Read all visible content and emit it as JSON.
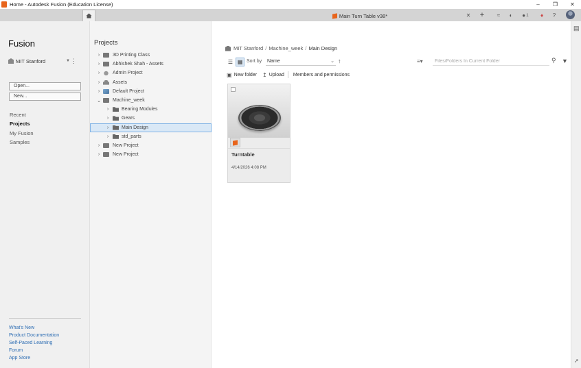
{
  "window": {
    "title": "Home - Autodesk Fusion (Education License)",
    "controls": [
      "minimize",
      "restore",
      "close"
    ]
  },
  "tabs": {
    "home_icon": "home-icon",
    "active_doc": "Main Turn Table v38*",
    "notification_count": "1"
  },
  "sidebar": {
    "brand": "Fusion",
    "hub": "MIT Stanford",
    "open_label": "Open...",
    "new_label": "New...",
    "nav": [
      {
        "label": "Recent",
        "active": false
      },
      {
        "label": "Projects",
        "active": true
      },
      {
        "label": "My Fusion",
        "active": false
      },
      {
        "label": "Samples",
        "active": false
      }
    ],
    "links": [
      "What's New",
      "Product Documentation",
      "Self-Paced Learning",
      "Forum",
      "App Store"
    ]
  },
  "projects": {
    "heading": "Projects",
    "tree": [
      {
        "label": "3D Printing Class",
        "level": 0,
        "icon": "project-icon",
        "expanded": false
      },
      {
        "label": "Abhishek Shah - Assets",
        "level": 0,
        "icon": "project-icon",
        "expanded": false
      },
      {
        "label": "Admin Project",
        "level": 0,
        "icon": "person-icon",
        "expanded": false
      },
      {
        "label": "Assets",
        "level": 0,
        "icon": "lock-icon",
        "expanded": false
      },
      {
        "label": "Default Project",
        "level": 0,
        "icon": "project-icon",
        "expanded": false
      },
      {
        "label": "Machine_week",
        "level": 0,
        "icon": "project-icon",
        "expanded": true
      },
      {
        "label": "Bearing Modules",
        "level": 1,
        "icon": "folder-icon",
        "expanded": false
      },
      {
        "label": "Gears",
        "level": 1,
        "icon": "folder-icon",
        "expanded": false
      },
      {
        "label": "Main Design",
        "level": 1,
        "icon": "folder-icon",
        "expanded": false,
        "selected": true
      },
      {
        "label": "std_parts",
        "level": 1,
        "icon": "folder-icon",
        "expanded": false
      },
      {
        "label": "New Project",
        "level": 0,
        "icon": "project-icon",
        "expanded": false
      },
      {
        "label": "New Project",
        "level": 0,
        "icon": "project-icon",
        "expanded": false
      }
    ]
  },
  "main": {
    "breadcrumb": [
      "MIT Stanford",
      "Machine_week",
      "Main Design"
    ],
    "sort_by_label": "Sort by",
    "sort_value": "Name",
    "search_placeholder": "Files/Folders In Current Folder",
    "actions": {
      "new_folder": "New folder",
      "upload": "Upload",
      "members": "Members and permissions"
    },
    "files": [
      {
        "name": "Turntable",
        "date": "4/14/2026 4:08 PM"
      }
    ]
  }
}
